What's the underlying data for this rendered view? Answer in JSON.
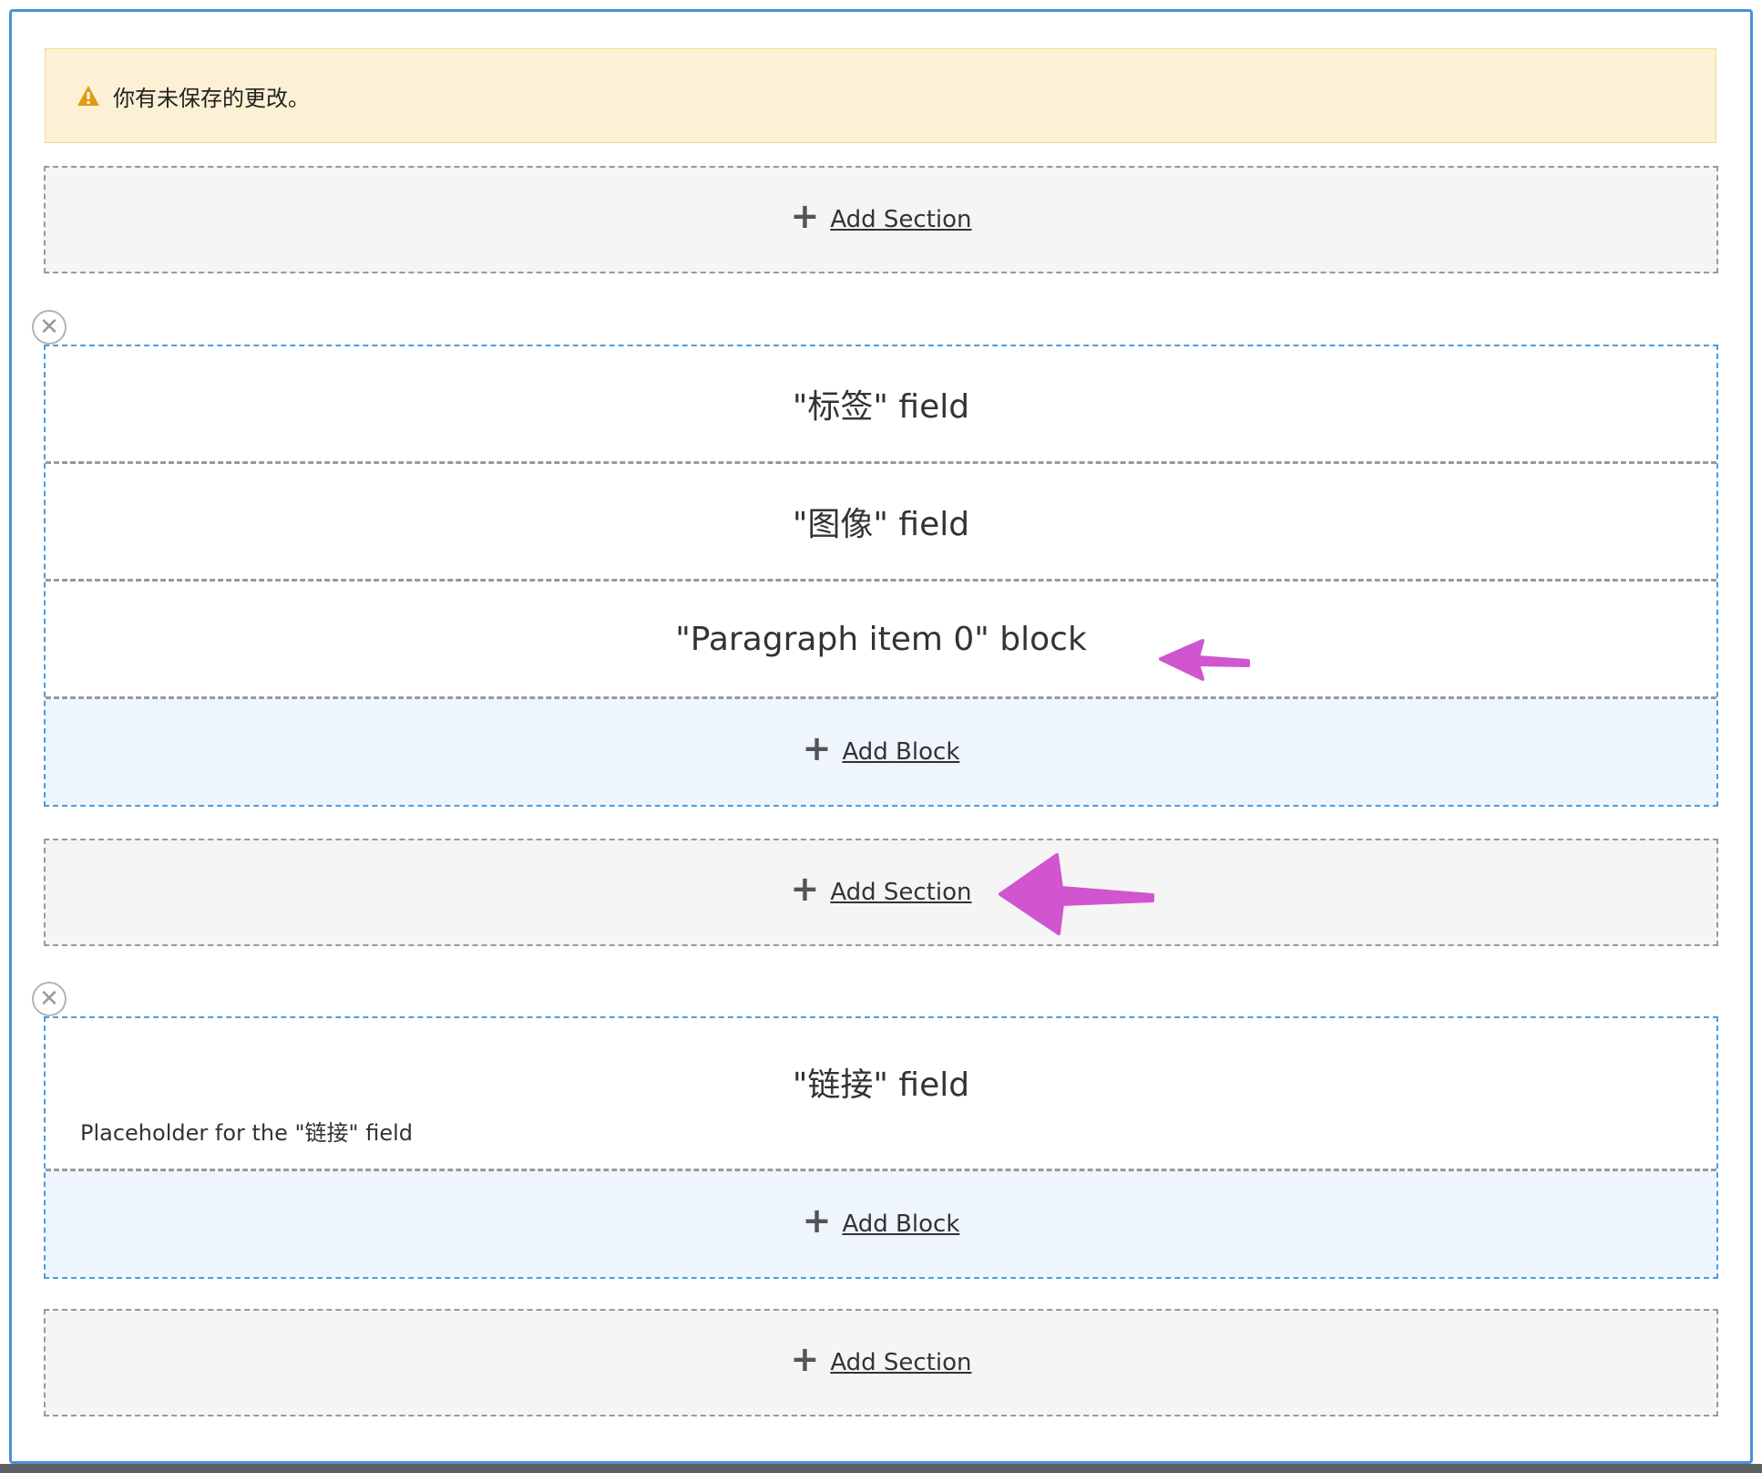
{
  "notice": {
    "message": "你有未保存的更改。",
    "icon": "warning-icon",
    "icon_color": "#e09b16"
  },
  "add_section_label": "Add Section",
  "add_block_label": "Add Block",
  "sections": [
    {
      "remove_icon": "close-icon",
      "blocks": [
        {
          "label": "\"标签\" field"
        },
        {
          "label": "\"图像\" field"
        },
        {
          "label": "\"Paragraph item 0\" block"
        }
      ]
    },
    {
      "remove_icon": "close-icon",
      "blocks": [
        {
          "label": "\"链接\" field",
          "placeholder": "Placeholder for the \"链接\" field"
        }
      ]
    }
  ],
  "annotations": {
    "arrow_color": "#d155cf"
  }
}
